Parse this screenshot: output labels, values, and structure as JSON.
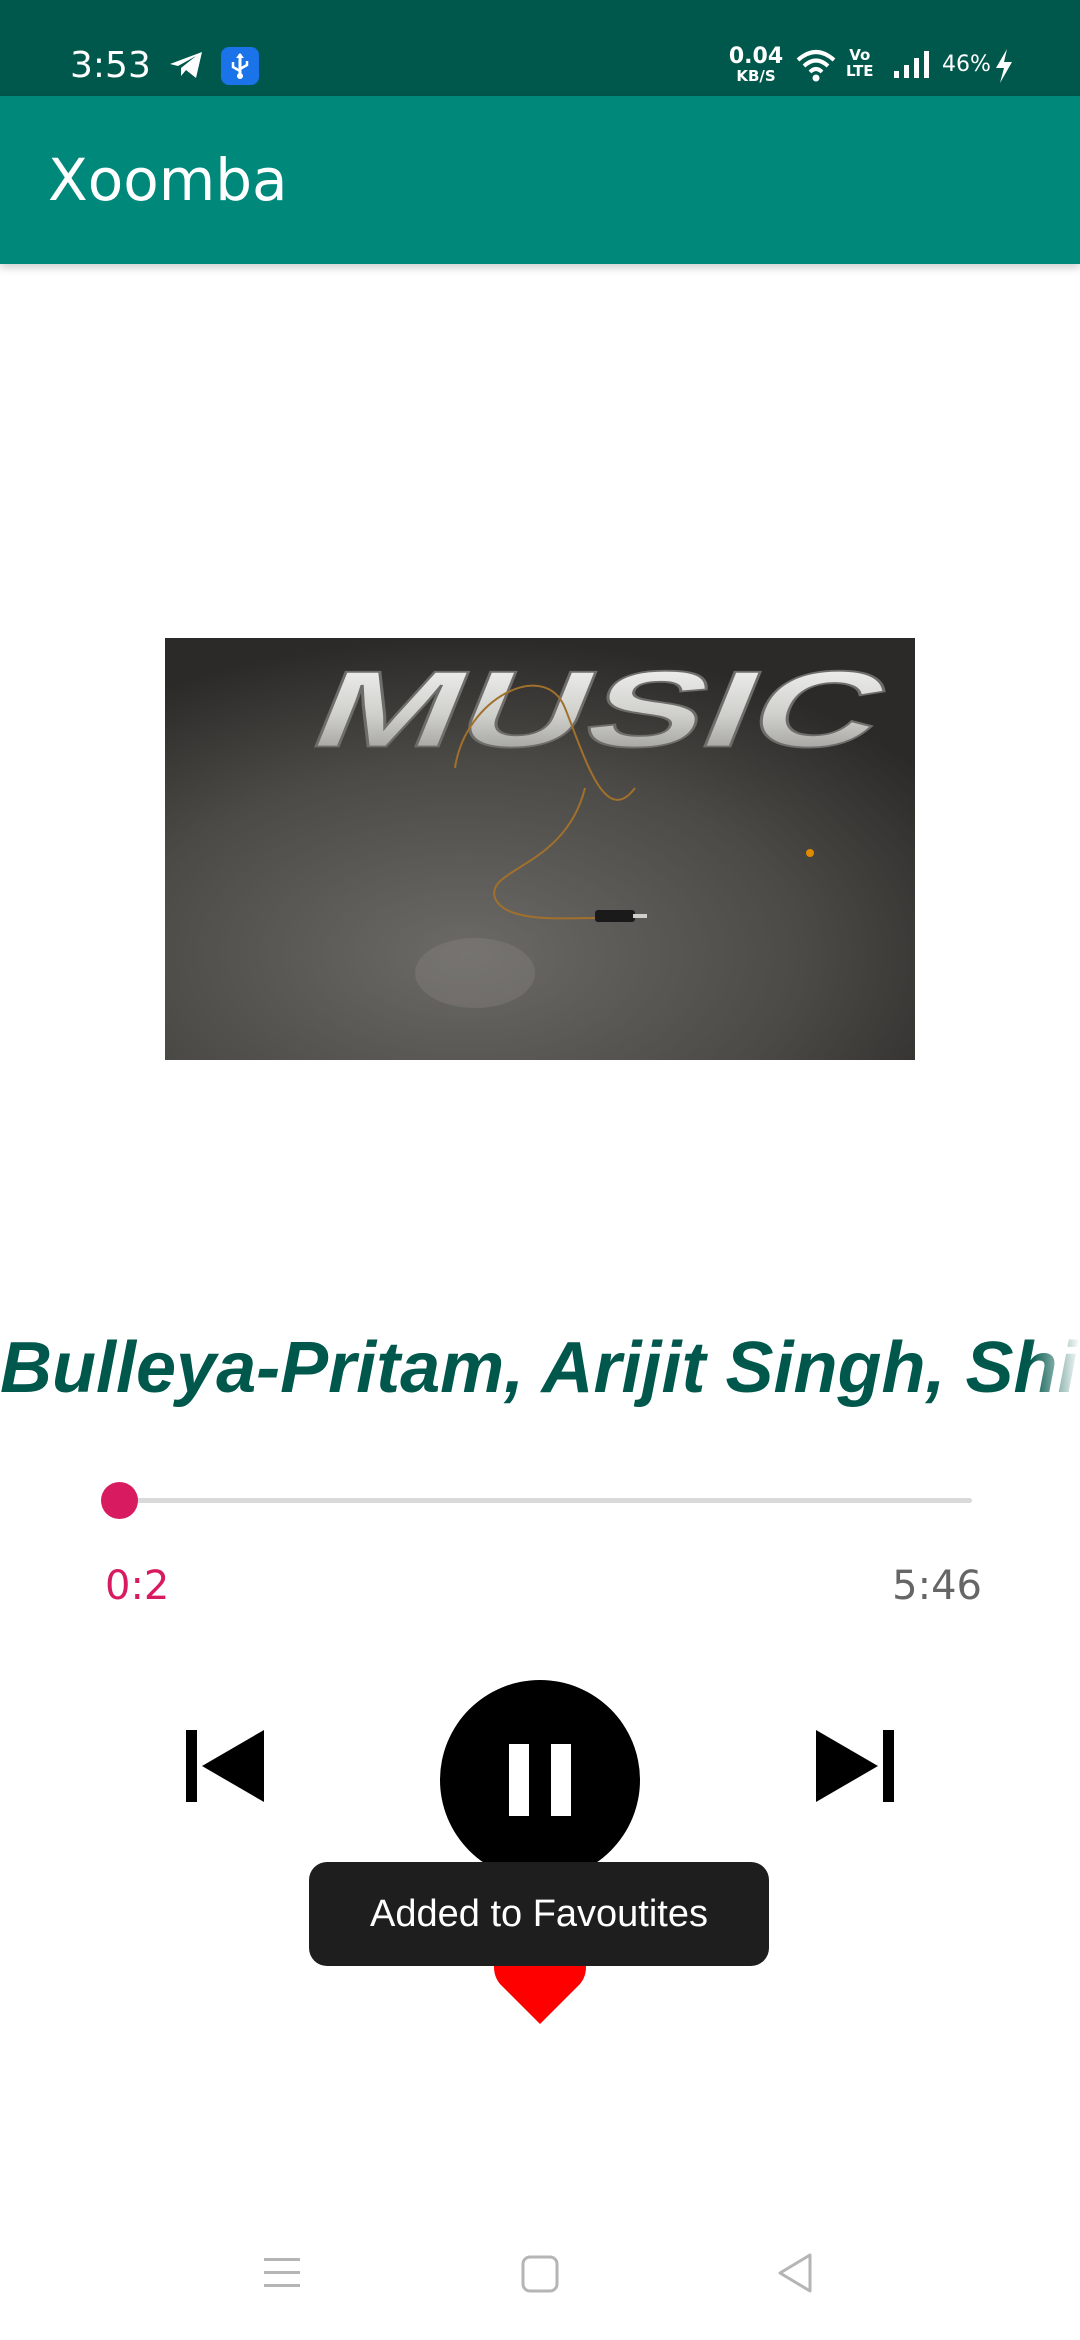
{
  "status_bar": {
    "time": "3:53",
    "net_speed_value": "0.04",
    "net_speed_unit": "KB/S",
    "volte_top": "Vo",
    "volte_bottom": "LTE",
    "battery": "46%",
    "icons": [
      "telegram-icon",
      "usb-debug-icon",
      "wifi-icon",
      "volte-icon",
      "signal-icon",
      "charging-icon"
    ]
  },
  "app_bar": {
    "title": "Xoomba"
  },
  "player": {
    "album_art_alt": "MUSIC",
    "song_title": "Bulleya-Pritam, Arijit Singh, Shilpa Rao",
    "current_time": "0:2",
    "total_time": "5:46",
    "progress": 0.006,
    "state": "playing",
    "controls": [
      "previous-icon",
      "pause-icon",
      "next-icon",
      "heart-icon"
    ]
  },
  "toast": {
    "message": "Added to Favoutites"
  },
  "nav_bar": {
    "icons": [
      "menu-icon",
      "home-icon",
      "back-icon"
    ]
  },
  "colors": {
    "status_bar": "#00574b",
    "app_bar": "#00897b",
    "title_text": "#00574b",
    "accent": "#d81b60",
    "heart": "#ff0000"
  }
}
